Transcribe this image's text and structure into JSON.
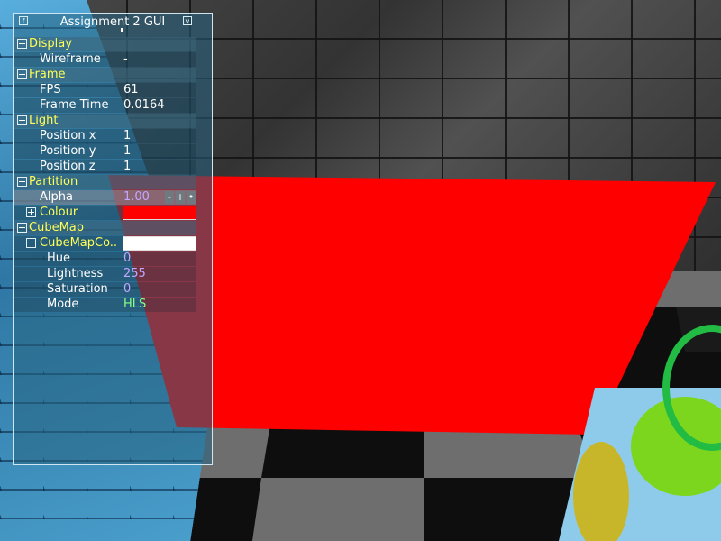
{
  "window": {
    "title": "Assignment 2 GUI"
  },
  "colors": {
    "partition_colour": "#ff0000",
    "cubemap_colour": "#ffffff",
    "group_label": "#ffff55",
    "edited_value": "#c4a6ff",
    "mode_value": "#88ff88"
  },
  "groups": {
    "display": {
      "label": "Display",
      "wireframe": {
        "label": "Wireframe",
        "value": "-"
      }
    },
    "frame": {
      "label": "Frame",
      "fps": {
        "label": "FPS",
        "value": "61"
      },
      "frame_time": {
        "label": "Frame Time",
        "value": "0.0164"
      }
    },
    "light": {
      "label": "Light",
      "position_x": {
        "label": "Position x",
        "value": "1"
      },
      "position_y": {
        "label": "Position y",
        "value": "1"
      },
      "position_z": {
        "label": "Position z",
        "value": "1"
      }
    },
    "partition": {
      "label": "Partition",
      "alpha": {
        "label": "Alpha",
        "value": "1.00",
        "decrement": "-",
        "increment": "+",
        "menu": "•"
      },
      "colour": {
        "label": "Colour"
      }
    },
    "cubemap": {
      "label": "CubeMap",
      "colour": {
        "label": "CubeMapCo..",
        "hue": {
          "label": "Hue",
          "value": "0"
        },
        "lightness": {
          "label": "Lightness",
          "value": "255"
        },
        "saturation": {
          "label": "Saturation",
          "value": "0"
        },
        "mode": {
          "label": "Mode",
          "value": "HLS"
        }
      }
    }
  },
  "icons": {
    "title_left": "f",
    "title_right": "v"
  }
}
